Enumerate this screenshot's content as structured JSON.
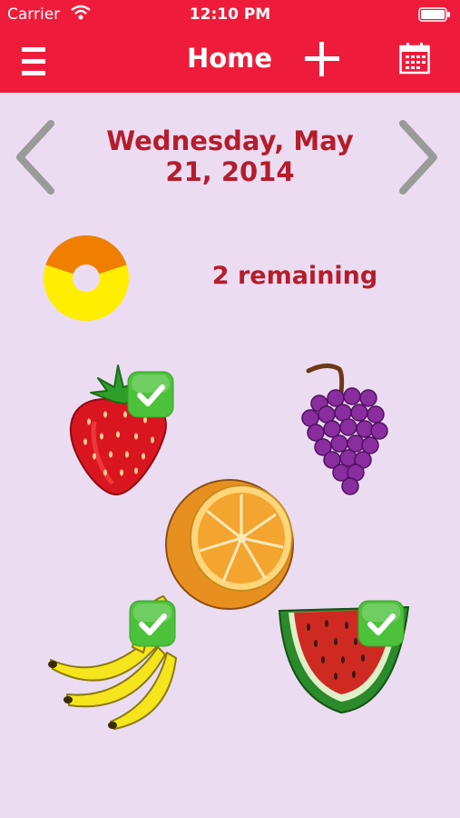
{
  "status_bar": {
    "carrier": "Carrier",
    "time": "12:10 PM"
  },
  "nav": {
    "menu_icon": "hamburger-menu-icon",
    "title": "Home",
    "add_icon": "plus-icon",
    "calendar_icon": "calendar-icon",
    "bar_color": "#ee1c3a"
  },
  "day": {
    "date_label": "Wednesday, May 21, 2014",
    "prev_icon": "chevron-left-icon",
    "next_icon": "chevron-right-icon"
  },
  "progress": {
    "remaining_label": "2 remaining",
    "completed": 3,
    "total": 5,
    "completed_color": "#ffee00",
    "remaining_color": "#f07f00"
  },
  "fruits": [
    {
      "name": "strawberry",
      "checked": true
    },
    {
      "name": "grapes",
      "checked": false
    },
    {
      "name": "orange",
      "checked": false
    },
    {
      "name": "banana",
      "checked": true
    },
    {
      "name": "watermelon",
      "checked": true
    }
  ],
  "colors": {
    "background": "#ecdcf2",
    "accent_text": "#b51d2c",
    "check_green": "#4cc23a"
  }
}
